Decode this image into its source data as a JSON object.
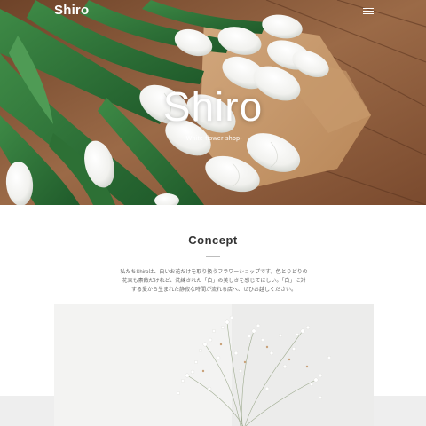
{
  "header": {
    "brand": "Shiro",
    "menu_icon": "hamburger-menu-icon"
  },
  "hero": {
    "title": "Shiro",
    "subtitle": "-White flower shop-"
  },
  "concept": {
    "title": "Concept",
    "lines": [
      "私たちShiroは、白いお花だけを取り扱うフラワーショップです。色とりどりの",
      "花束も素敵だけれど、洗練された「白」の美しさを感じてほしい。「白」に対",
      "する愛から生まれた静寂な時間が流れる店へ、ぜひお越しください。"
    ]
  },
  "colors": {
    "hero_text": "#ffffff",
    "heading": "#333333",
    "body_text": "#666666",
    "band": "#eeeeee"
  }
}
